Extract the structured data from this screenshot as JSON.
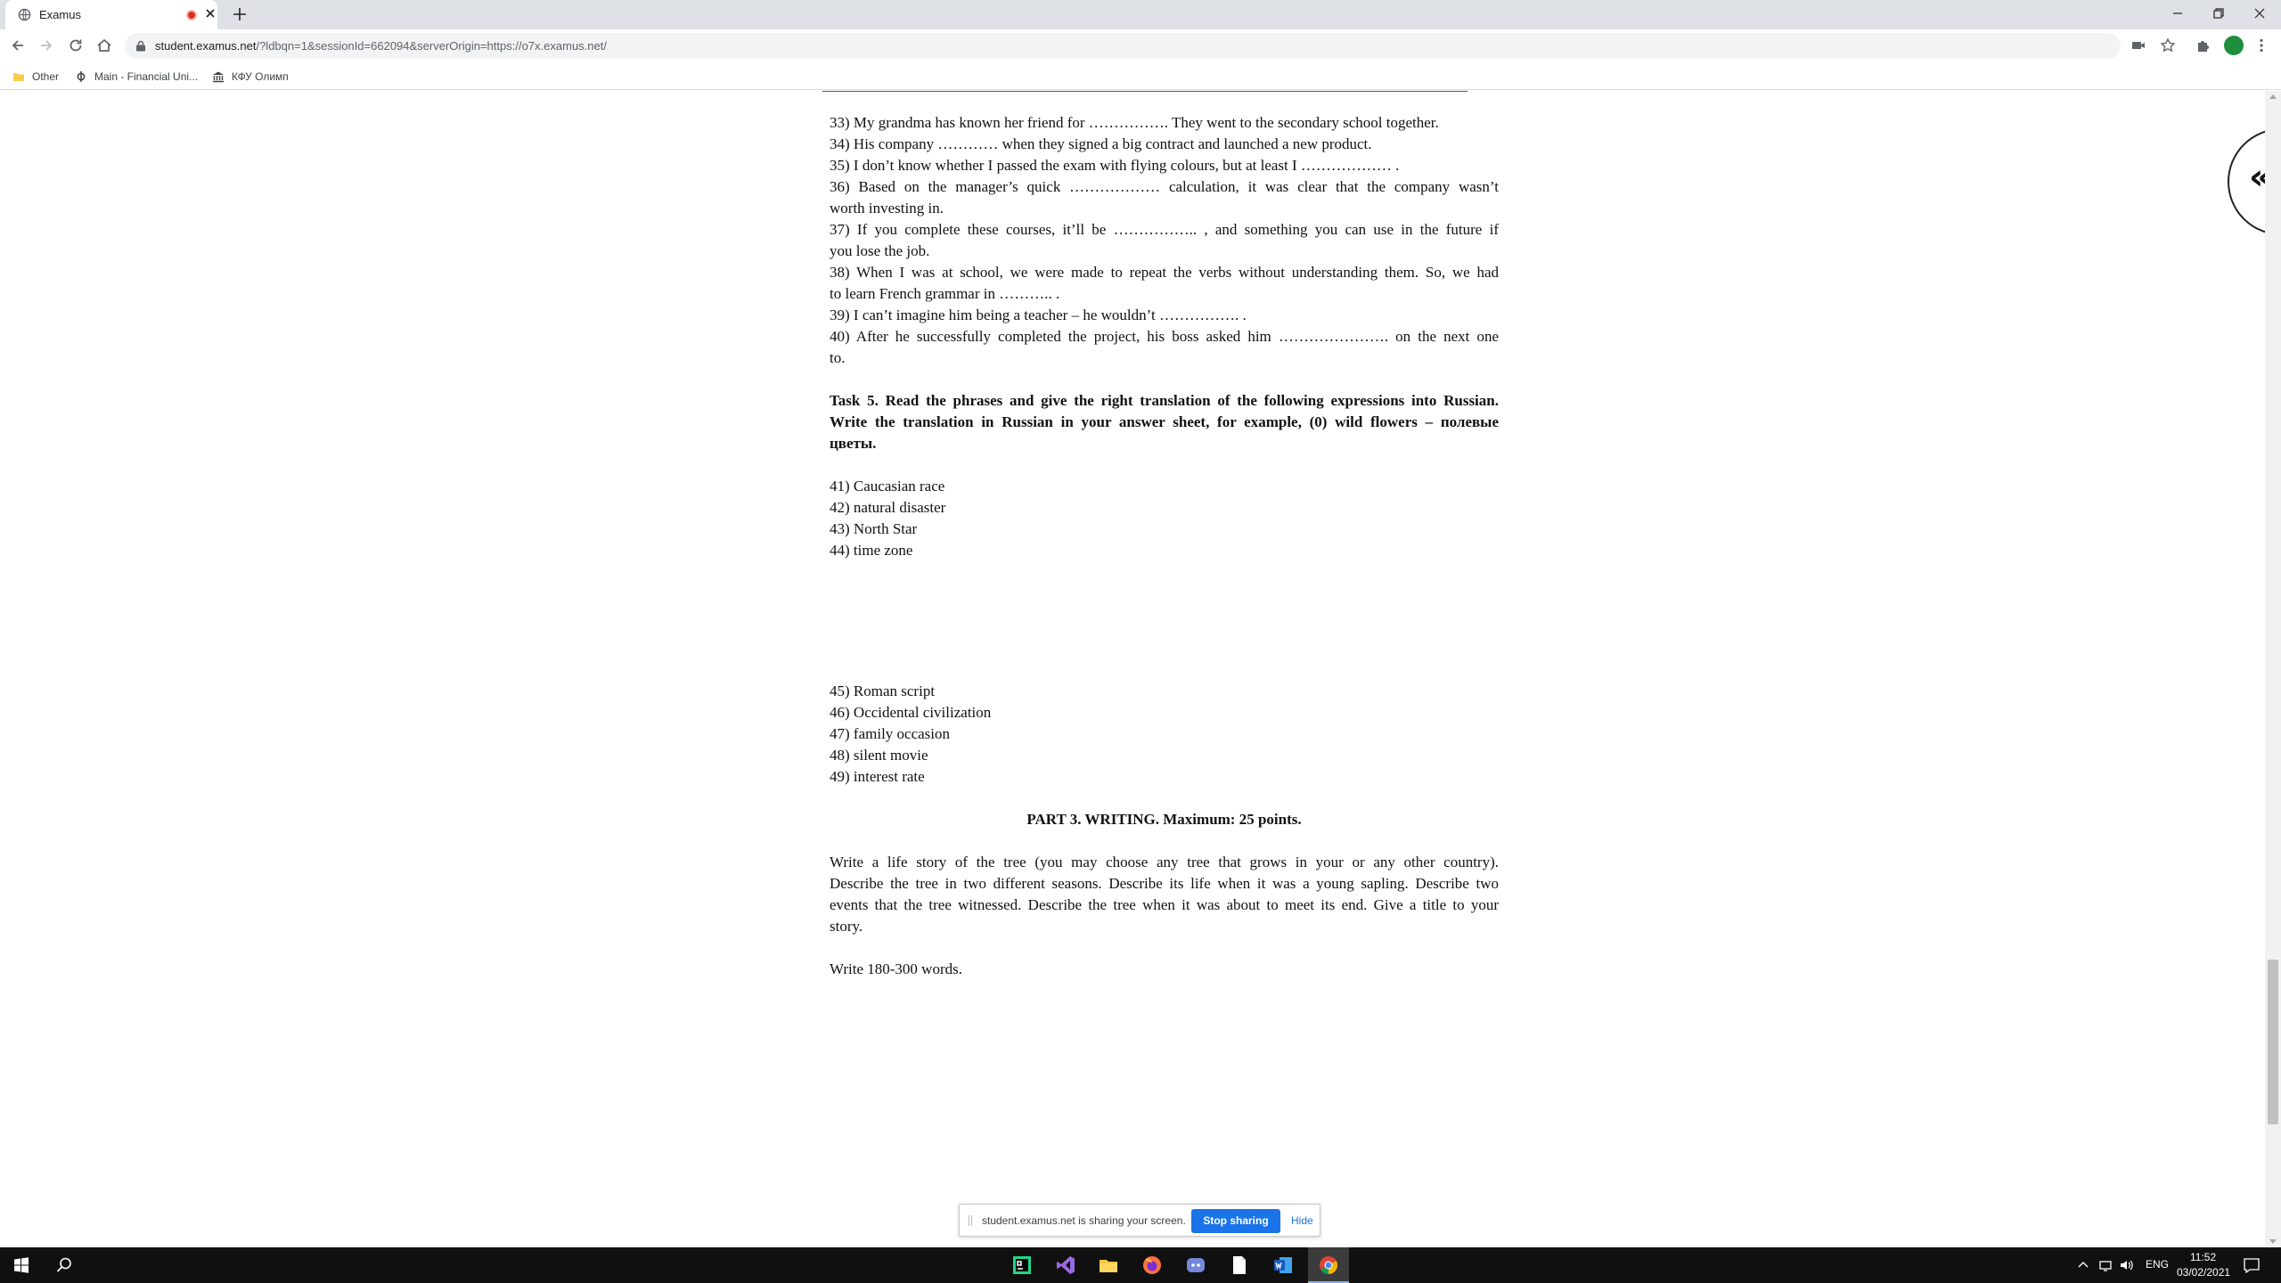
{
  "browser": {
    "tab": {
      "title": "Examus"
    },
    "address": {
      "host": "student.examus.net",
      "path": "/?ldbqn=1&sessionId=662094&serverOrigin=https://o7x.examus.net/"
    },
    "bookmarks": [
      {
        "label": "Other",
        "icon": "folder-icon"
      },
      {
        "label": "Main - Financial Uni...",
        "icon": "phi-icon"
      },
      {
        "label": "КФУ Олимп",
        "icon": "institution-icon"
      }
    ]
  },
  "document": {
    "items_a": [
      [
        "33) My grandma has known her friend for ……………. They went to the secondary school together."
      ],
      [
        "34) His company ………… when they signed a big contract and launched a new product."
      ],
      [
        "35) I don’t know whether I passed the exam with flying colours, but at least I ……………… ."
      ],
      [
        "36) Based on the manager’s quick ……………… calculation, it was clear that the company wasn’t",
        "worth investing in."
      ],
      [
        "37) If you complete these courses, it’ll be …………….. , and something you can use in the future if",
        "you lose the job."
      ],
      [
        "38) When I was at school, we were made to repeat the verbs without understanding them. So, we had",
        "to learn French grammar in ……….. ."
      ],
      [
        "39) I can’t imagine him being a teacher – he wouldn’t ……………. ."
      ],
      [
        "40) After he successfully completed the project, his boss asked him …………………. on the next one",
        "to."
      ]
    ],
    "task5": [
      "Task 5. Read the phrases and give the right translation of the following expressions into Russian.",
      "Write the translation in Russian in your answer sheet, for example, (0) wild flowers – полевые",
      "цветы."
    ],
    "phrases_1": [
      "41) Caucasian race",
      "42) natural disaster",
      "43) North Star",
      "44) time zone"
    ],
    "phrases_2": [
      "45) Roman script",
      "46) Occidental civilization",
      "47) family occasion",
      "48) silent movie",
      "49) interest rate"
    ],
    "part3_heading": "PART 3. WRITING. Maximum: 25 points.",
    "writing_prompt": [
      "Write a life story of the tree (you may choose any tree that grows in your or any other country).",
      "Describe the tree in two different seasons. Describe its life when it was a young sapling. Describe two",
      "events that the tree witnessed. Describe the tree when it was about to meet its end. Give a title to your",
      "story."
    ],
    "word_count": "Write 180-300 words."
  },
  "side_toggle": {
    "label": "«"
  },
  "sharing": {
    "message": "student.examus.net is sharing your screen.",
    "stop_label": "Stop sharing",
    "hide_label": "Hide"
  },
  "taskbar": {
    "apps": [
      "pycharm-icon",
      "visual-studio-icon",
      "file-explorer-icon",
      "firefox-icon",
      "discord-icon",
      "notepad-icon",
      "word-icon",
      "chrome-icon"
    ],
    "language": "ENG",
    "time": "11:52",
    "date": "03/02/2021"
  },
  "colors": {
    "accent": "#1a73e8",
    "recording": "#d93025",
    "taskbar": "#101010"
  }
}
